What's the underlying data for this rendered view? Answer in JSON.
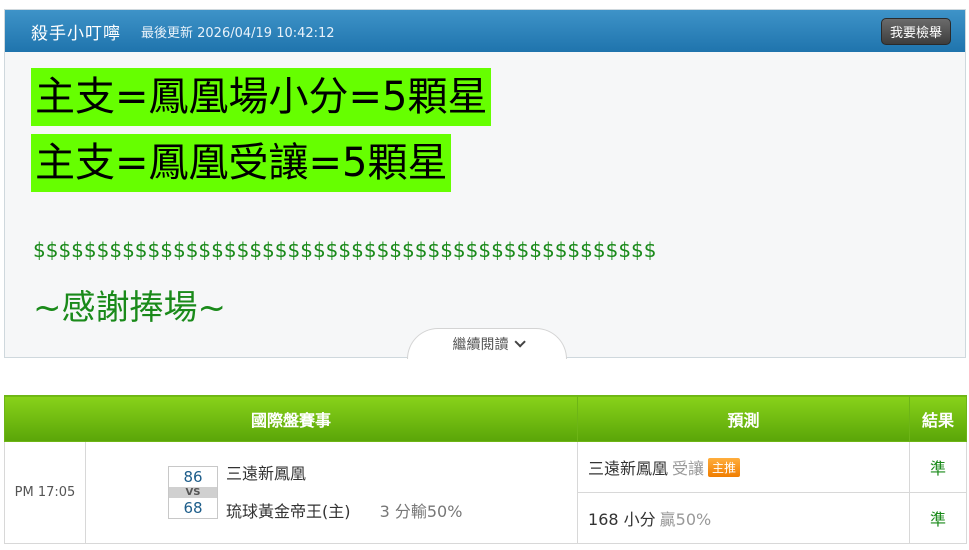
{
  "header": {
    "author": "殺手小叮嚀",
    "updated": "最後更新 2026/04/19 10:42:12",
    "report_button": "我要檢舉"
  },
  "article": {
    "line1": "主支=鳳凰場小分=5顆星",
    "line2": "主支=鳳凰受讓=5顆星",
    "dollars": "$$$$$$$$$$$$$$$$$$$$$$$$$$$$$$$$$$$$$$$$$$$$$$$$$",
    "thanks": "~感謝捧場~",
    "read_more": "繼續閱讀",
    "highlight_color": "#66ff00",
    "text_color_green": "#1a8a1a"
  },
  "table": {
    "headers": [
      "國際盤賽事",
      "預測",
      "結果"
    ],
    "match": {
      "time": "PM 17:05",
      "home_score": "86",
      "vs": "VS",
      "away_score": "68",
      "home_team": "三遠新鳳凰",
      "away_team": "琉球黃金帝王(主)",
      "note": "3 分輸50%"
    },
    "predictions": [
      {
        "main": "三遠新鳳凰",
        "muted": "受讓",
        "badge": "主推",
        "result": "準"
      },
      {
        "main": "168 小分",
        "muted": "贏50%",
        "result": "準"
      }
    ]
  },
  "colors": {
    "header_blue": "#2a80b9",
    "table_header_green": "#6cbb12",
    "badge_orange": "#f08a10"
  }
}
